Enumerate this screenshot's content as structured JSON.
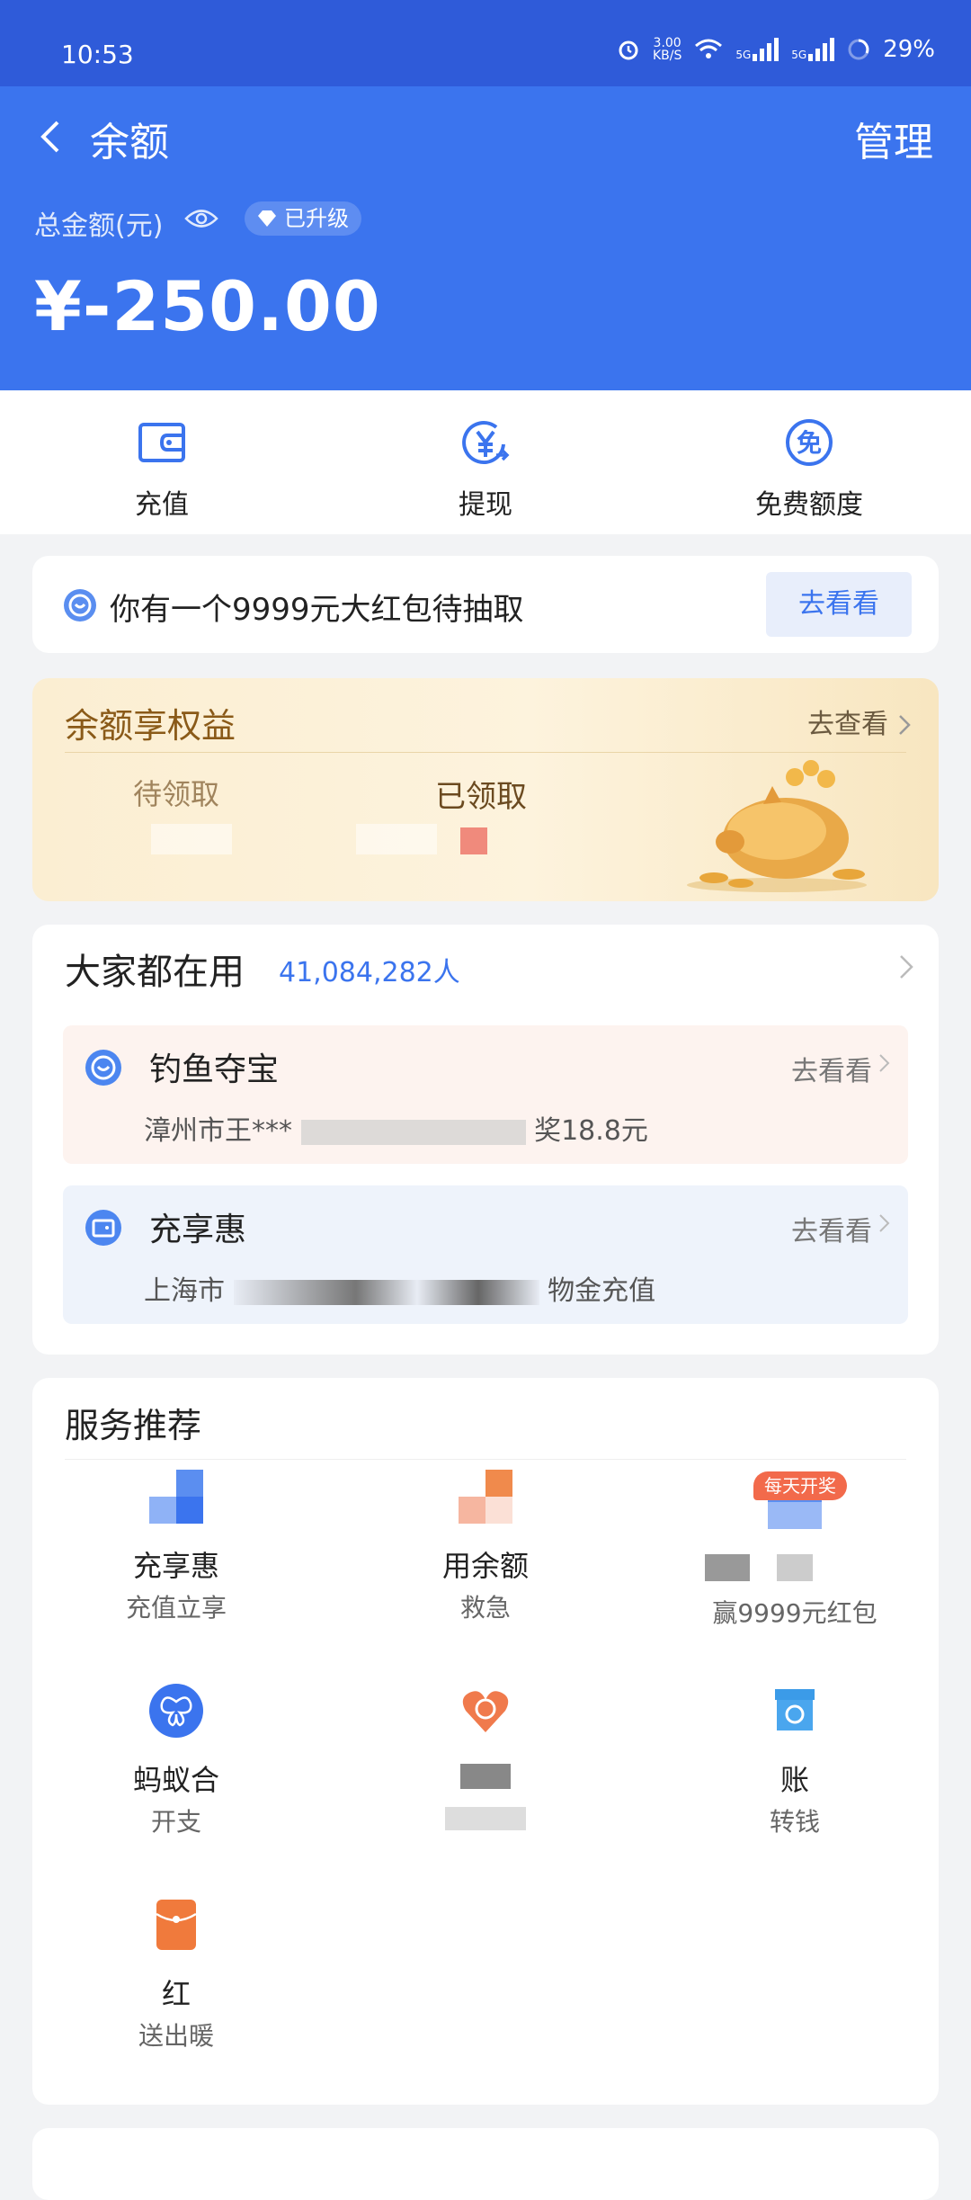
{
  "status_bar": {
    "time": "10:53",
    "speed_value": "3.00",
    "speed_unit": "KB/S",
    "net1": "5G",
    "net2": "5G",
    "battery": "29%"
  },
  "header": {
    "back_icon": "chevron-left-icon",
    "title": "余额",
    "manage": "管理",
    "total_label": "总金额(元)",
    "eye_icon": "eye-icon",
    "badge": "已升级",
    "amount": "¥-250.00"
  },
  "quick_actions": [
    {
      "label": "充值",
      "icon": "wallet-icon"
    },
    {
      "label": "提现",
      "icon": "yuan-withdraw-icon"
    },
    {
      "label": "免费额度",
      "icon": "free-quota-icon"
    }
  ],
  "promo": {
    "text": "你有一个9999元大红包待抽取",
    "button": "去看看"
  },
  "benefits": {
    "title": "余额享权益",
    "link": "去查看",
    "pending": "待领取",
    "received": "已领取"
  },
  "users": {
    "title": "大家都在用",
    "count": "41,084,282人",
    "items": [
      {
        "name": "钓鱼夺宝",
        "go": "去看看",
        "desc_start": "漳州市王***",
        "desc_end": "奖18.8元"
      },
      {
        "name": "充享惠",
        "go": "去看看",
        "desc_start": "上海市",
        "desc_end": "物金充值"
      }
    ]
  },
  "services": {
    "title": "服务推荐",
    "badge": "每天开奖",
    "items": [
      {
        "label": "充享惠",
        "desc": "充值立享"
      },
      {
        "label": "用余额",
        "desc": "救急"
      },
      {
        "label": "",
        "desc": "赢9999元红包"
      },
      {
        "label": "蚂蚁合",
        "desc": "开支"
      },
      {
        "label": "",
        "desc": ""
      },
      {
        "label": "账",
        "desc": "转钱"
      },
      {
        "label": "红",
        "desc": "送出暖"
      }
    ]
  },
  "colors": {
    "brand_blue": "#3b74ee",
    "status_blue": "#2f5bd9",
    "gold_text": "#8a5a18"
  }
}
